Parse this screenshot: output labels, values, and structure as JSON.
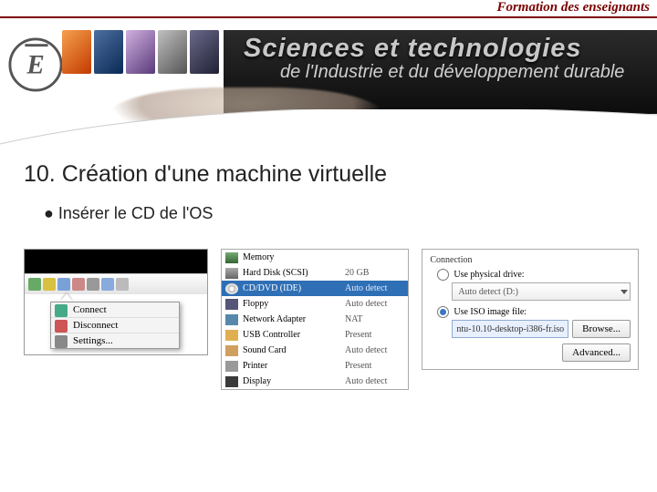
{
  "header": {
    "teacher_line": "Formation des enseignants",
    "title_big": "Sciences et technologies",
    "title_sub": "de l'Industrie et du développement durable"
  },
  "slide": {
    "heading": "10. Création d'une machine virtuelle",
    "bullet1": "Insérer le CD de l'OS"
  },
  "ctxmenu": {
    "connect": "Connect",
    "disconnect": "Disconnect",
    "settings": "Settings..."
  },
  "hw": {
    "rows": [
      {
        "name": "Memory",
        "state": ""
      },
      {
        "name": "Hard Disk (SCSI)",
        "state": "20 GB"
      },
      {
        "name": "CD/DVD (IDE)",
        "state": "Auto detect"
      },
      {
        "name": "Floppy",
        "state": "Auto detect"
      },
      {
        "name": "Network Adapter",
        "state": "NAT"
      },
      {
        "name": "USB Controller",
        "state": "Present"
      },
      {
        "name": "Sound Card",
        "state": "Auto detect"
      },
      {
        "name": "Printer",
        "state": "Present"
      },
      {
        "name": "Display",
        "state": "Auto detect"
      }
    ]
  },
  "conn": {
    "group": "Connection",
    "opt_physical": "Use physical drive:",
    "physical_value": "Auto detect (D:)",
    "opt_iso": "Use ISO image file:",
    "iso_value": "ntu-10.10-desktop-i386-fr.iso",
    "browse": "Browse...",
    "advanced": "Advanced..."
  }
}
